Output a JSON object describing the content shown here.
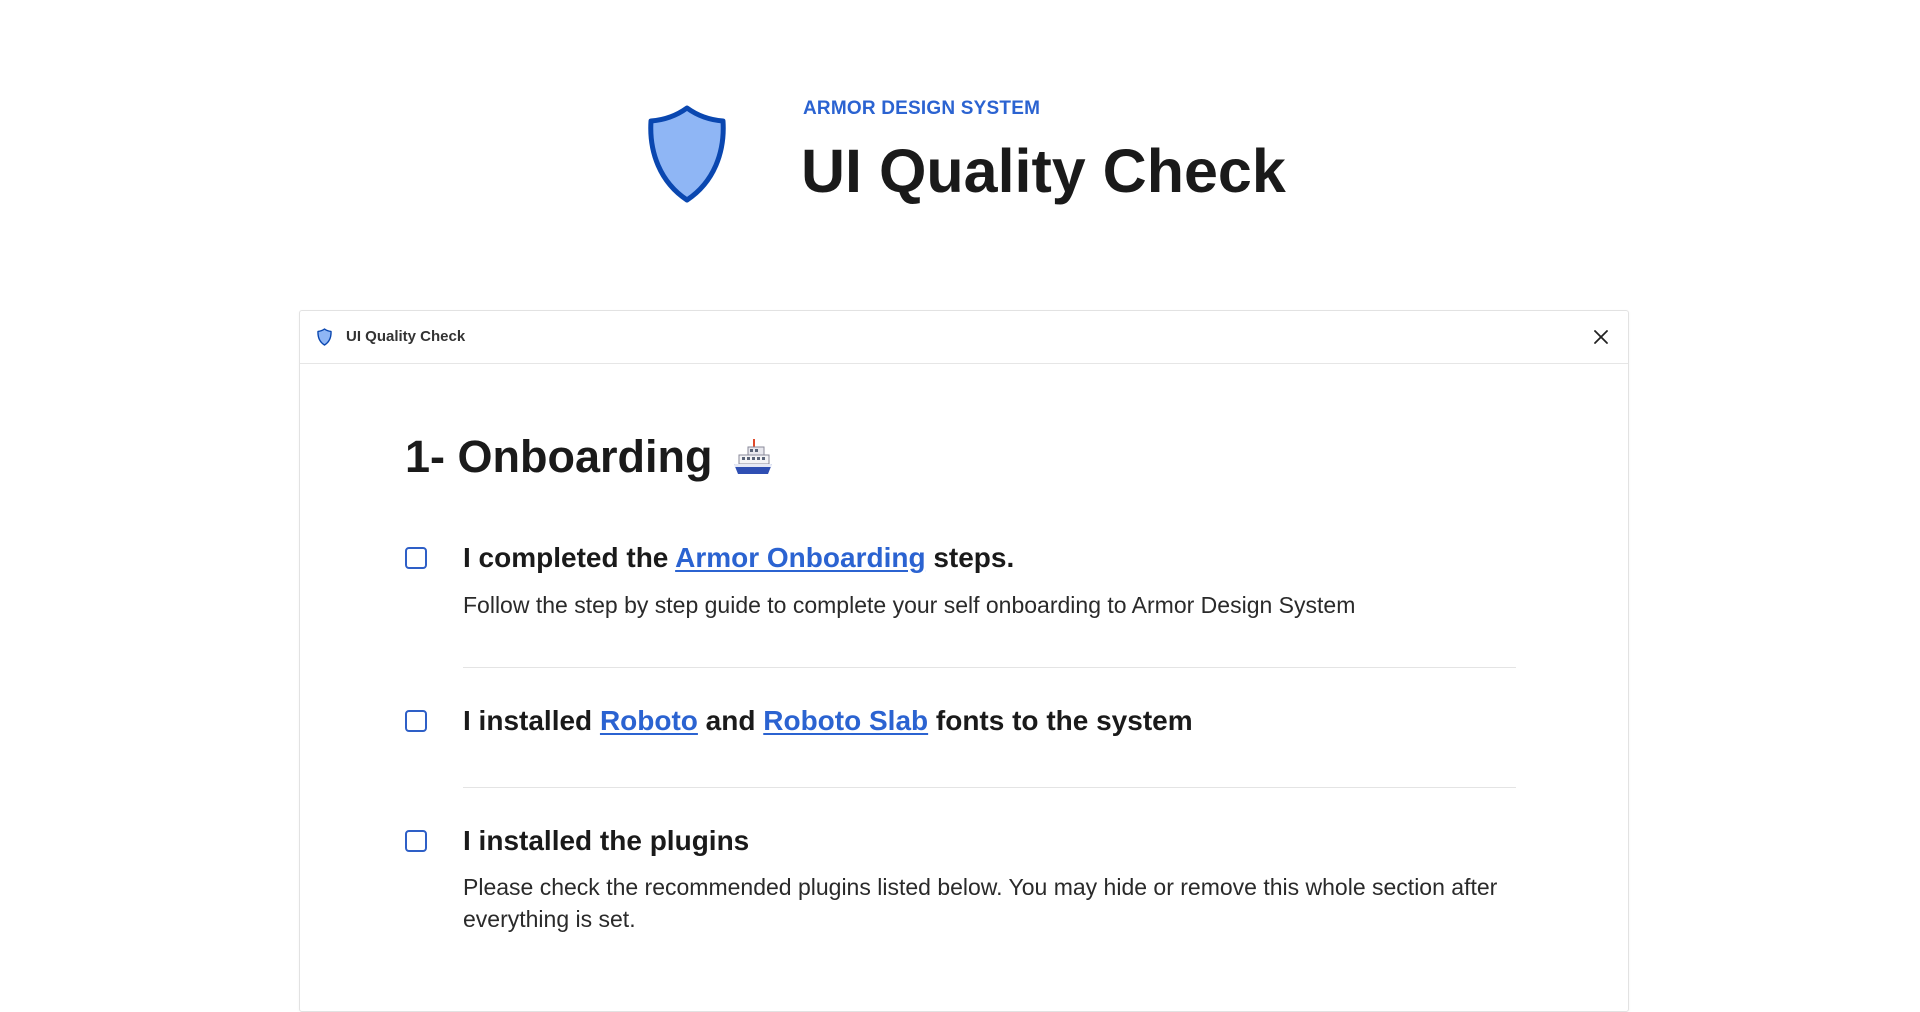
{
  "hero": {
    "kicker": "ARMOR DESIGN SYSTEM",
    "title": "UI Quality Check",
    "icon": "shield-icon"
  },
  "window": {
    "title": "UI Quality Check",
    "icon": "shield-icon",
    "close_icon": "close-icon"
  },
  "section": {
    "heading": "1- Onboarding",
    "emoji_icon": "ship-icon"
  },
  "items": [
    {
      "checked": false,
      "title_prefix": "I completed the ",
      "title_link": "Armor Onboarding",
      "title_suffix": " steps.",
      "description": "Follow the step by step guide to complete your self onboarding to Armor Design System"
    },
    {
      "checked": false,
      "title_prefix": "I installed ",
      "title_link_1": "Roboto",
      "title_middle": " and ",
      "title_link_2": "Roboto Slab",
      "title_suffix": " fonts to the system"
    },
    {
      "checked": false,
      "title": "I installed the plugins",
      "description": "Please check the recommended plugins listed below. You may hide or remove this whole section after everything is set."
    }
  ],
  "colors": {
    "accent": "#2b63d1",
    "shield_fill": "#8fb6f5",
    "shield_stroke": "#0a47b0",
    "text": "#1a1a1a"
  }
}
